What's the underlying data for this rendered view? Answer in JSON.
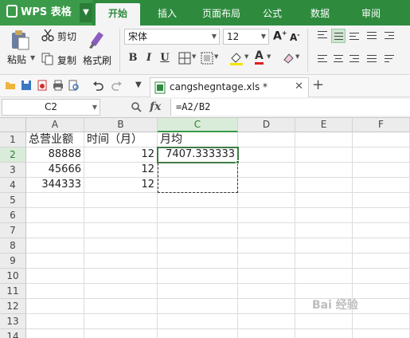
{
  "app": {
    "name": "WPS 表格",
    "tabs": [
      {
        "label": "开始",
        "active": true
      },
      {
        "label": "插入",
        "active": false
      },
      {
        "label": "页面布局",
        "active": false
      },
      {
        "label": "公式",
        "active": false
      },
      {
        "label": "数据",
        "active": false
      },
      {
        "label": "审阅",
        "active": false
      }
    ]
  },
  "ribbon": {
    "paste": "粘贴",
    "cut": "剪切",
    "copy": "复制",
    "format_painter": "格式刷",
    "font_name": "宋体",
    "font_size": "12",
    "bold": "B",
    "italic": "I",
    "underline": "U"
  },
  "document": {
    "tab_name": "cangshegntage.xls *"
  },
  "formula_bar": {
    "name_box": "C2",
    "fx": "fx",
    "formula": "=A2/B2"
  },
  "sheet": {
    "columns": [
      "A",
      "B",
      "C",
      "D",
      "E",
      "F"
    ],
    "rows": [
      "1",
      "2",
      "3",
      "4",
      "5",
      "6",
      "7",
      "8",
      "9",
      "10",
      "11",
      "12",
      "13",
      "14"
    ],
    "cells": {
      "A1": "总营业额",
      "B1": "时间（月）",
      "C1": "月均",
      "A2": "88888",
      "B2": "12",
      "C2": "7407.333333",
      "A3": "45666",
      "B3": "12",
      "A4": "344333",
      "B4": "12"
    },
    "active_cell": "C2",
    "active_column": "C",
    "active_row": "2"
  },
  "colors": {
    "brand_green": "#2e8b3e",
    "selection_green": "#3f7c46"
  },
  "watermark": "Bai 经验"
}
